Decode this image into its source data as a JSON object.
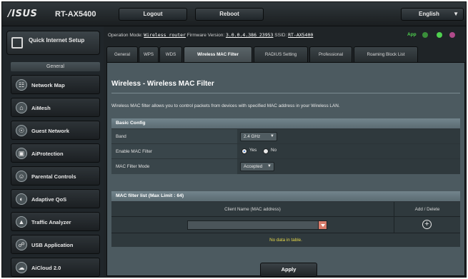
{
  "header": {
    "brand": "/ISUS",
    "model": "RT-AX5400",
    "logout_label": "Logout",
    "reboot_label": "Reboot",
    "language": "English"
  },
  "status_bar": {
    "operation_mode_label": "Operation Mode:",
    "operation_mode_value": "Wireless router",
    "firmware_label": "Firmware Version:",
    "firmware_value": "3.0.0.4.386_23953",
    "ssid_label": "SSID:",
    "ssid_value": "RT-AX5400",
    "app_label": "App",
    "icon_colors": [
      "#3a8f3a",
      "#4fd04f",
      "#b04a8a"
    ]
  },
  "sidebar": {
    "quick_setup_label": "Quick Internet Setup",
    "section_label": "General",
    "items": [
      {
        "label": "Network Map",
        "icon": "network-map-icon"
      },
      {
        "label": "AiMesh",
        "icon": "aimesh-icon"
      },
      {
        "label": "Guest Network",
        "icon": "guest-network-icon"
      },
      {
        "label": "AiProtection",
        "icon": "aiprotection-icon"
      },
      {
        "label": "Parental Controls",
        "icon": "parental-controls-icon"
      },
      {
        "label": "Adaptive QoS",
        "icon": "adaptive-qos-icon"
      },
      {
        "label": "Traffic Analyzer",
        "icon": "traffic-analyzer-icon"
      },
      {
        "label": "USB Application",
        "icon": "usb-application-icon"
      },
      {
        "label": "AiCloud 2.0",
        "icon": "aicloud-icon"
      }
    ]
  },
  "tabs": [
    {
      "label": "General",
      "active": false
    },
    {
      "label": "WPS",
      "active": false
    },
    {
      "label": "WDS",
      "active": false
    },
    {
      "label": "Wireless MAC Filter",
      "active": true
    },
    {
      "label": "RADIUS Setting",
      "active": false
    },
    {
      "label": "Professional",
      "active": false
    },
    {
      "label": "Roaming Block List",
      "active": false
    }
  ],
  "main": {
    "title": "Wireless - Wireless MAC Filter",
    "description": "Wireless MAC filter allows you to control packets from devices with specified MAC address in your Wireless LAN.",
    "basic_config": {
      "heading": "Basic Config",
      "band_label": "Band",
      "band_value": "2.4 GHz",
      "enable_label": "Enable MAC Filter",
      "enable_yes": "Yes",
      "enable_no": "No",
      "enable_selected": "Yes",
      "mode_label": "MAC Filter Mode",
      "mode_value": "Accepted"
    },
    "mac_list": {
      "heading": "MAC filter list (Max Limit : 64)",
      "col_client": "Client Name (MAC address)",
      "col_action": "Add / Delete",
      "input_value": "",
      "empty_text": "No data in table."
    },
    "apply_label": "Apply"
  }
}
